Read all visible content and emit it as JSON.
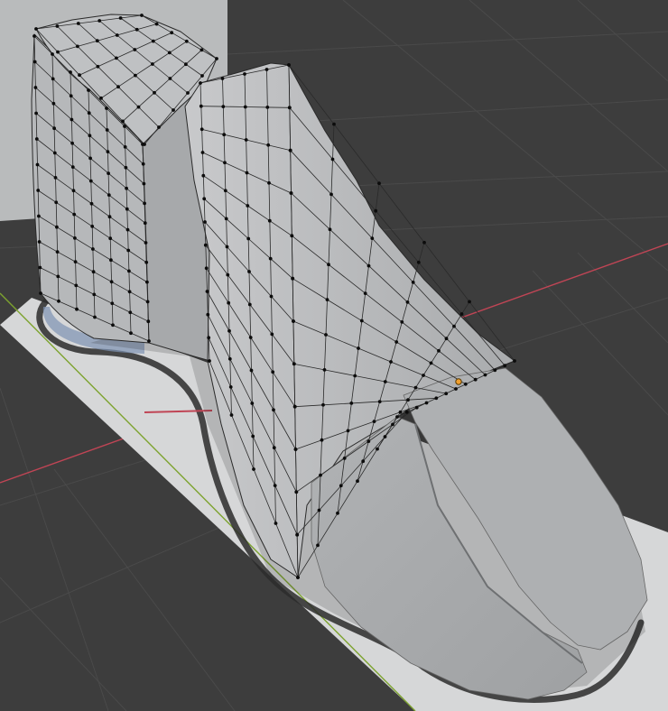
{
  "viewport": {
    "background": "#3d3d3d",
    "grid_color": "#4a4a4a",
    "axis_x_color": "#c04555",
    "axis_y_color": "#7da32f",
    "reference_image": "foot-sole-outline",
    "mesh": {
      "object": "foot-mesh",
      "mode": "edit",
      "face_color": "#b4b6b8",
      "edge_color": "#2a2a2a",
      "vertex_color": "#0c0c0c",
      "pivot_color": "#f0a030",
      "shadow_color": "#1e1e1e"
    },
    "icons": {
      "origin": "origin-pivot-icon",
      "vertex": "vertex-dot-icon"
    }
  }
}
